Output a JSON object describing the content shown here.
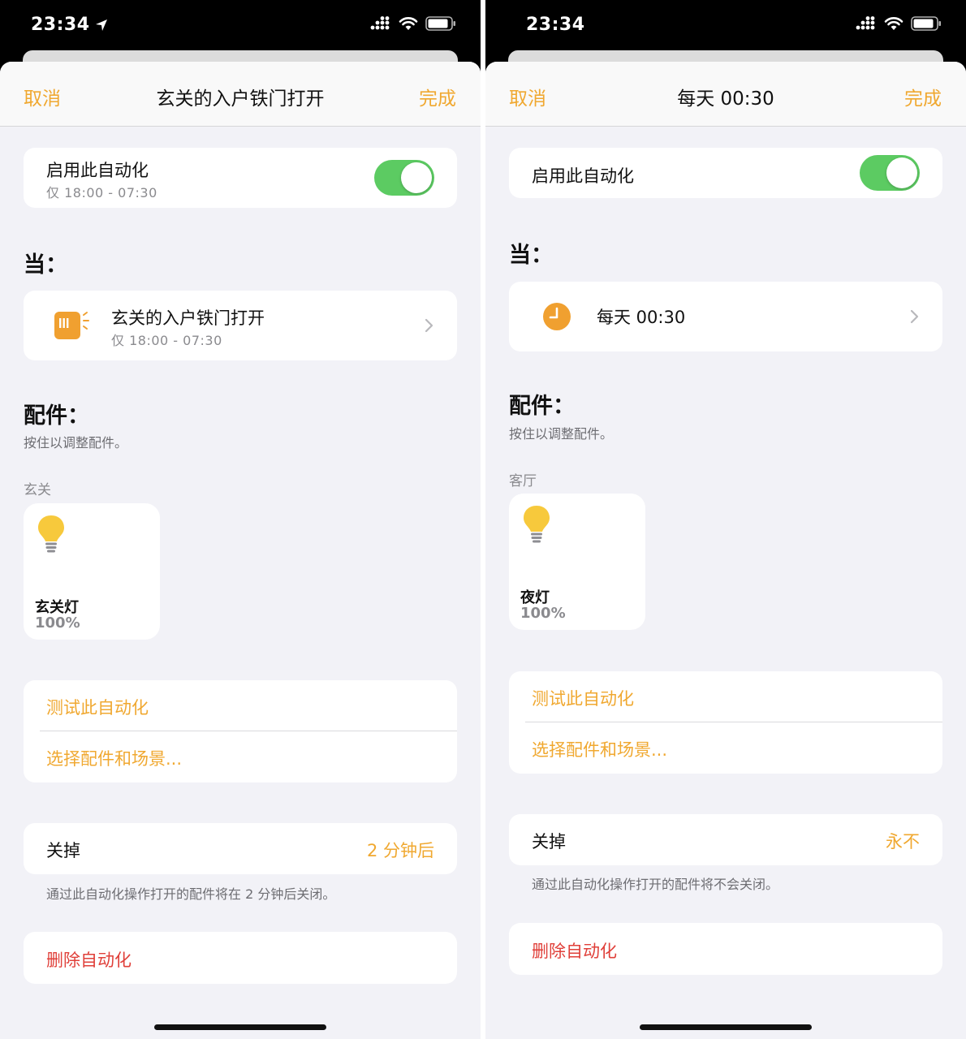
{
  "left": {
    "status": {
      "time": "23:34"
    },
    "nav": {
      "cancel": "取消",
      "title": "玄关的入户铁门打开",
      "done": "完成"
    },
    "enable": {
      "title": "启用此自动化",
      "subtitle": "仅 18:00 - 07:30",
      "enabled": true
    },
    "when": {
      "heading": "当："
    },
    "trigger": {
      "title": "玄关的入户铁门打开",
      "subtitle": "仅 18:00 - 07:30",
      "icon": "door-sensor-icon"
    },
    "accessories": {
      "heading": "配件：",
      "hint": "按住以调整配件。",
      "room": "玄关",
      "item": {
        "name": "玄关灯",
        "value": "100%",
        "icon": "lightbulb-icon"
      }
    },
    "actions": {
      "test": "测试此自动化",
      "choose": "选择配件和场景..."
    },
    "turn_off": {
      "label": "关掉",
      "value": "2 分钟后",
      "note": "通过此自动化操作打开的配件将在 2 分钟后关闭。"
    },
    "delete_label": "删除自动化"
  },
  "right": {
    "status": {
      "time": "23:34"
    },
    "nav": {
      "cancel": "取消",
      "title": "每天 00:30",
      "done": "完成"
    },
    "enable": {
      "title": "启用此自动化",
      "enabled": true
    },
    "when": {
      "heading": "当："
    },
    "trigger": {
      "title": "每天 00:30",
      "icon": "clock-icon"
    },
    "accessories": {
      "heading": "配件：",
      "hint": "按住以调整配件。",
      "room": "客厅",
      "item": {
        "name": "夜灯",
        "value": "100%",
        "icon": "lightbulb-icon"
      }
    },
    "actions": {
      "test": "测试此自动化",
      "choose": "选择配件和场景..."
    },
    "turn_off": {
      "label": "关掉",
      "value": "永不",
      "note": "通过此自动化操作打开的配件将不会关闭。"
    },
    "delete_label": "删除自动化"
  },
  "colors": {
    "accent": "#f0a830",
    "toggle_on": "#5ccb62",
    "destructive": "#e0403a",
    "bulb": "#f7c93c",
    "sheet_bg": "#f2f2f7"
  }
}
